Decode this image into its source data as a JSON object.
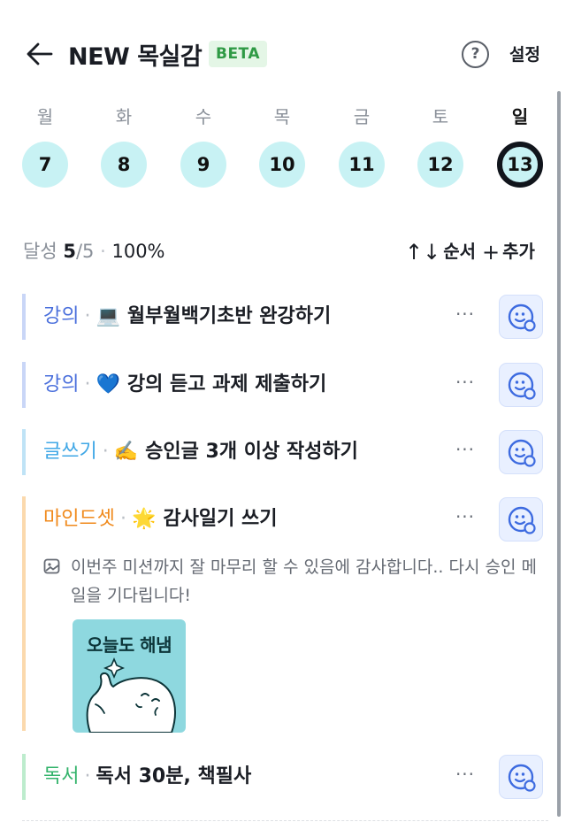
{
  "header": {
    "back_icon": "arrow-left-icon",
    "title": "NEW 목실감",
    "badge": "BETA",
    "help_label": "?",
    "settings_label": "설정"
  },
  "week": {
    "days": [
      {
        "label": "월",
        "date": "7",
        "active": false
      },
      {
        "label": "화",
        "date": "8",
        "active": false
      },
      {
        "label": "수",
        "date": "9",
        "active": false
      },
      {
        "label": "목",
        "date": "10",
        "active": false
      },
      {
        "label": "금",
        "date": "11",
        "active": false
      },
      {
        "label": "토",
        "date": "12",
        "active": false
      },
      {
        "label": "일",
        "date": "13",
        "active": true
      }
    ]
  },
  "stats": {
    "label": "달성",
    "done": "5",
    "slash": "/",
    "total": "5",
    "separator": "·",
    "percent": "100%"
  },
  "toolbar": {
    "order_icon": "↑↓",
    "order_label": "순서",
    "add_icon": "+",
    "add_label": "추가"
  },
  "colors": {
    "lecture": "#4a6fdc",
    "writing": "#3fa7e6",
    "mindset": "#f08a1c",
    "reading": "#33b36b",
    "bar_lecture": "#c9d6f7",
    "bar_writing": "#bfe3f6",
    "bar_mindset": "#fbd9ad",
    "bar_reading": "#bdeccd"
  },
  "tasks": [
    {
      "category": "강의",
      "separator": "·",
      "emoji": "💻",
      "name": "월부월백기초반 완강하기",
      "more": "···",
      "react_icon": "smiley-add-icon"
    },
    {
      "category": "강의",
      "separator": "·",
      "emoji": "💙",
      "name": "강의 듣고 과제 제출하기",
      "more": "···",
      "react_icon": "smiley-add-icon"
    },
    {
      "category": "글쓰기",
      "separator": "·",
      "emoji": "✍️",
      "name": "승인글 3개 이상 작성하기",
      "more": "···",
      "react_icon": "smiley-add-icon"
    },
    {
      "category": "마인드셋",
      "separator": "·",
      "emoji": "🌟",
      "name": "감사일기 쓰기",
      "more": "···",
      "react_icon": "smiley-add-icon",
      "note": "이번주 미션까지 잘 마무리 할 수 있음에 감사합니다.. 다시 승인 메일을 기다립니다!",
      "sticker_text": "오늘도 해냄"
    },
    {
      "category": "독서",
      "separator": "·",
      "emoji": "",
      "name": "독서 30분, 책필사",
      "more": "···",
      "react_icon": "smiley-add-icon"
    }
  ]
}
